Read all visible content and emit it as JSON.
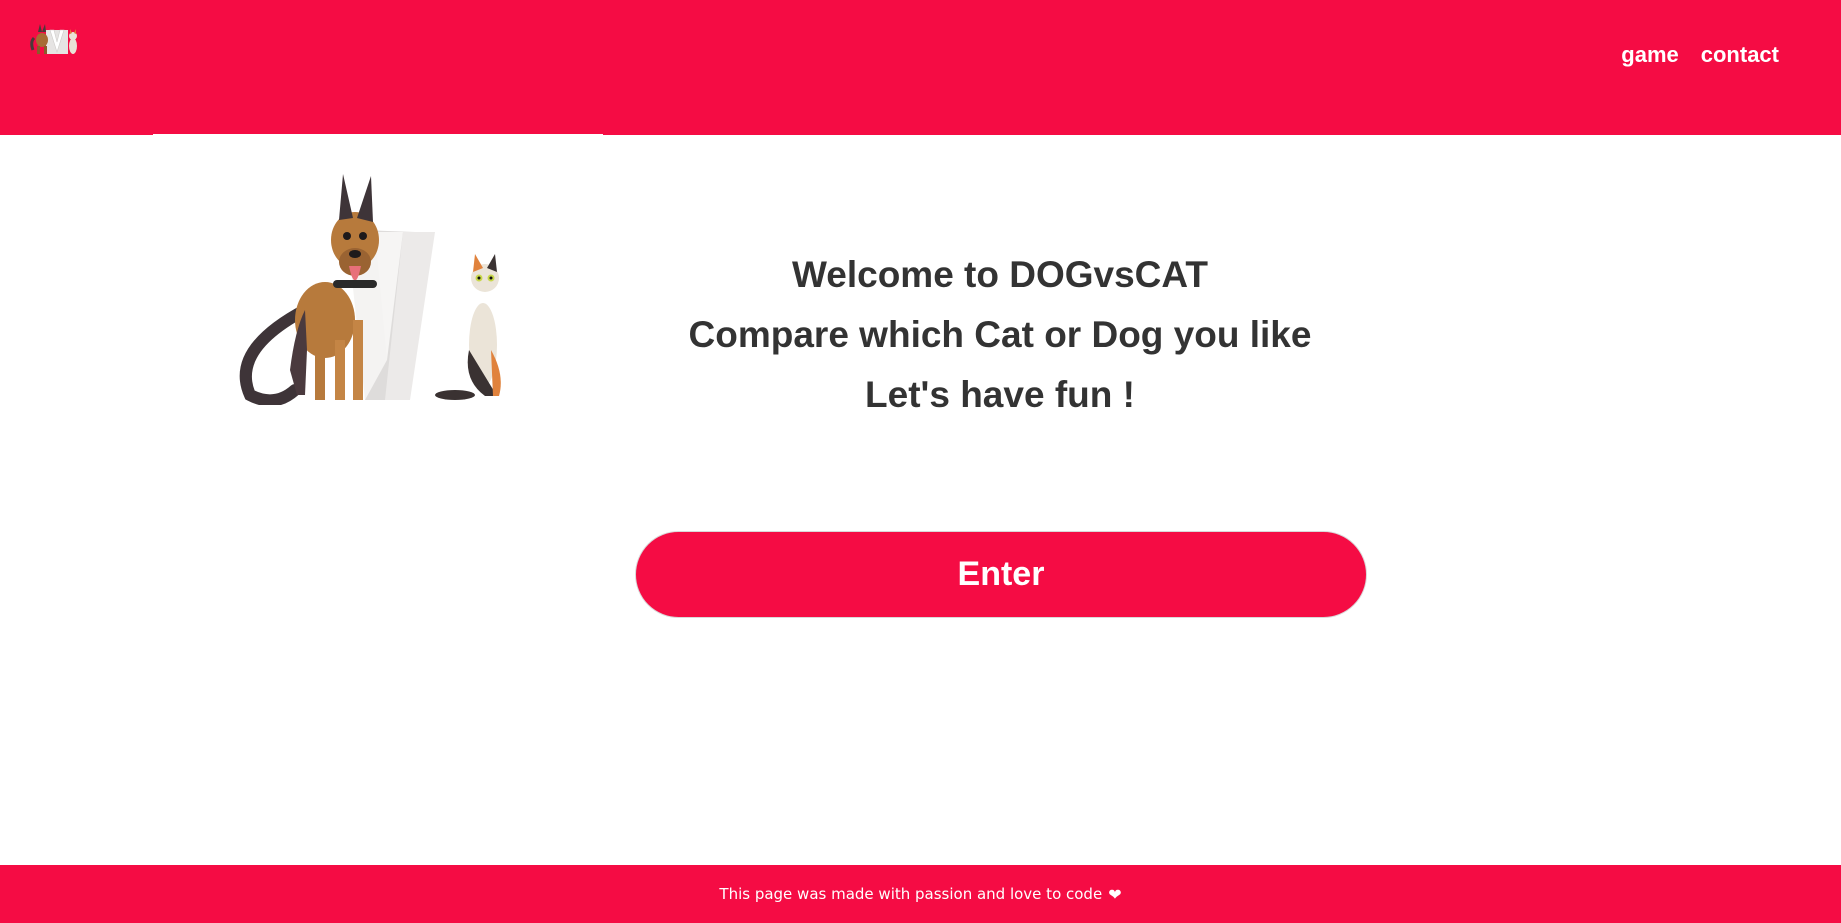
{
  "header": {
    "nav": [
      {
        "label": "game"
      },
      {
        "label": "contact"
      }
    ],
    "logo_icon": "dog-vs-cat-logo",
    "background_color": "#f50c44"
  },
  "main": {
    "hero_image_icon": "dog-vs-cat-illustration",
    "welcome_lines": [
      "Welcome to DOGvsCAT",
      "Compare which Cat or Dog you like",
      "Let's have fun !"
    ],
    "enter_label": "Enter"
  },
  "footer": {
    "text": "This page was made with passion and love to code",
    "heart_icon": "heart-icon",
    "heart_glyph": "❤"
  },
  "colors": {
    "accent": "#f50c44",
    "text": "#333333"
  }
}
